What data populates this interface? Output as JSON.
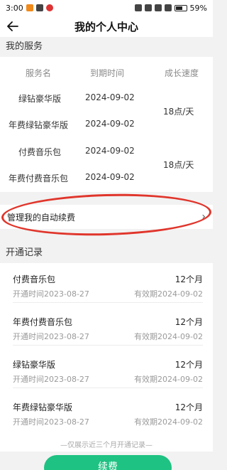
{
  "status_bar": {
    "time": "3:00",
    "battery": "59%"
  },
  "header": {
    "title": "我的个人中心"
  },
  "services": {
    "section_title": "我的服务",
    "columns": [
      "服务名",
      "到期时间",
      "成长速度"
    ],
    "rows": [
      {
        "name": "绿钻豪华版",
        "expire": "2024-09-02"
      },
      {
        "name": "年费绿钻豪华版",
        "expire": "2024-09-02"
      },
      {
        "name": "付费音乐包",
        "expire": "2024-09-02"
      },
      {
        "name": "年费付费音乐包",
        "expire": "2024-09-02"
      }
    ],
    "speeds": [
      "18点/天",
      "18点/天"
    ]
  },
  "manage": {
    "label": "管理我的自动续费",
    "arrow": "›"
  },
  "records": {
    "section_title": "开通记录",
    "items": [
      {
        "name": "付费音乐包",
        "months": "12个月",
        "opened": "开通时间2023-08-27",
        "valid": "有效期2024-09-02"
      },
      {
        "name": "年费付费音乐包",
        "months": "12个月",
        "opened": "开通时间2023-08-27",
        "valid": "有效期2024-09-02"
      },
      {
        "name": "绿钻豪华版",
        "months": "12个月",
        "opened": "开通时间2023-08-27",
        "valid": "有效期2024-09-02"
      },
      {
        "name": "年费绿钻豪华版",
        "months": "12个月",
        "opened": "开通时间2023-08-27",
        "valid": "有效期2024-09-02"
      }
    ],
    "note": "—仅展示近三个月开通记录—"
  },
  "renew_button": {
    "label": "续费"
  },
  "colors": {
    "accent": "#1ec282",
    "annotation_red": "#e0352b"
  }
}
